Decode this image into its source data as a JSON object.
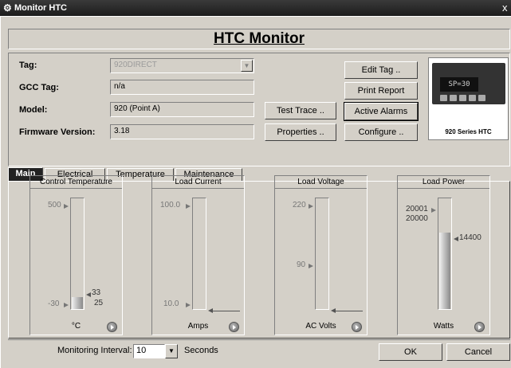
{
  "window": {
    "title": "Monitor HTC",
    "close": "x"
  },
  "header": {
    "title": "HTC Monitor"
  },
  "info": {
    "tag_label": "Tag:",
    "tag_value": "920DIRECT",
    "gcc_label": "GCC Tag:",
    "gcc_value": "n/a",
    "model_label": "Model:",
    "model_value": "920 (Point A)",
    "firmware_label": "Firmware Version:",
    "firmware_value": "3.18"
  },
  "buttons": {
    "test_trace": "Test Trace ..",
    "properties": "Properties ..",
    "edit_tag": "Edit Tag ..",
    "print_report": "Print Report",
    "active_alarms": "Active Alarms",
    "configure": "Configure .."
  },
  "device": {
    "screen": "SP=30",
    "caption": "920 Series HTC"
  },
  "tabs": [
    {
      "label": "Main",
      "active": true
    },
    {
      "label": "Electrical",
      "active": false
    },
    {
      "label": "Temperature",
      "active": false
    },
    {
      "label": "Maintenance",
      "active": false
    }
  ],
  "gauges": [
    {
      "title": "Control Temperature",
      "unit": "°C",
      "max_label": "500",
      "min_label": "-30",
      "marker_label": "33",
      "value_label": "25",
      "value_fraction": 0.105,
      "marker_fraction": 0.12
    },
    {
      "title": "Load Current",
      "unit": "Amps",
      "max_label": "100.0",
      "min_label": "10.0",
      "value_fraction": 0.0
    },
    {
      "title": "Load Voltage",
      "unit": "AC Volts",
      "max_label": "220",
      "mid_label": "90",
      "value_fraction": 0.0
    },
    {
      "title": "Load Power",
      "unit": "Watts",
      "max_label": "20001",
      "max_value_label": "20000",
      "marker_label": "14400",
      "value_fraction": 0.69,
      "marker_fraction": 0.69
    }
  ],
  "bottom": {
    "interval_label": "Monitoring Interval:",
    "interval_value": "10",
    "seconds_label": "Seconds",
    "ok": "OK",
    "cancel": "Cancel"
  },
  "colors": {
    "window_bg": "#d4d0c8",
    "titlebar": "#2a2a2a",
    "tab_active": "#222222"
  }
}
